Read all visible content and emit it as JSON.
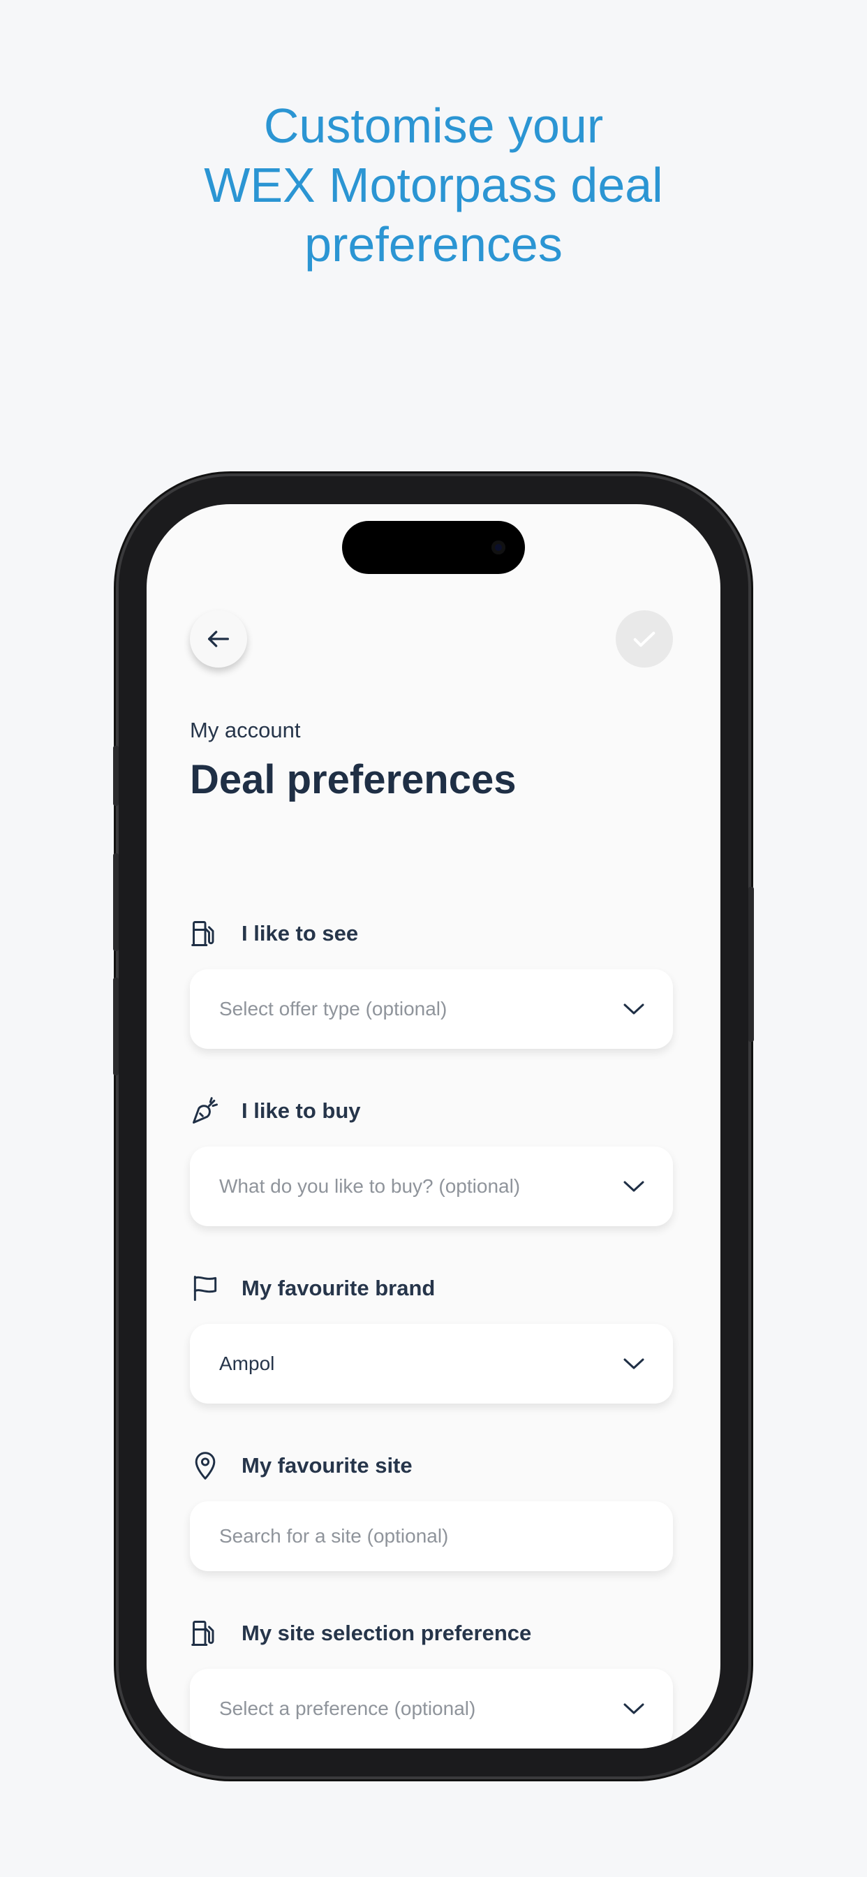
{
  "headline": {
    "line1": "Customise your",
    "line2": "WEX Motorpass deal",
    "line3": "preferences"
  },
  "header": {
    "back_icon": "arrow-left-icon",
    "confirm_icon": "check-icon",
    "eyebrow": "My account",
    "title": "Deal preferences"
  },
  "sections": [
    {
      "label": "I like to see",
      "icon": "fuel-pump-icon",
      "placeholder": "Select offer type (optional)",
      "type": "dropdown"
    },
    {
      "label": "I like to buy",
      "icon": "carrot-icon",
      "placeholder": "What do you like to buy? (optional)",
      "type": "dropdown"
    },
    {
      "label": "My favourite brand",
      "icon": "flag-icon",
      "value": "Ampol",
      "type": "dropdown"
    },
    {
      "label": "My favourite site",
      "icon": "map-pin-icon",
      "placeholder": "Search for a site (optional)",
      "type": "search"
    },
    {
      "label": "My site selection preference",
      "icon": "fuel-pump-icon",
      "placeholder": "Select a preference (optional)",
      "type": "dropdown"
    }
  ],
  "colors": {
    "headline": "#2b95d3",
    "text_dark": "#1f2f45",
    "placeholder": "#8f949b"
  }
}
